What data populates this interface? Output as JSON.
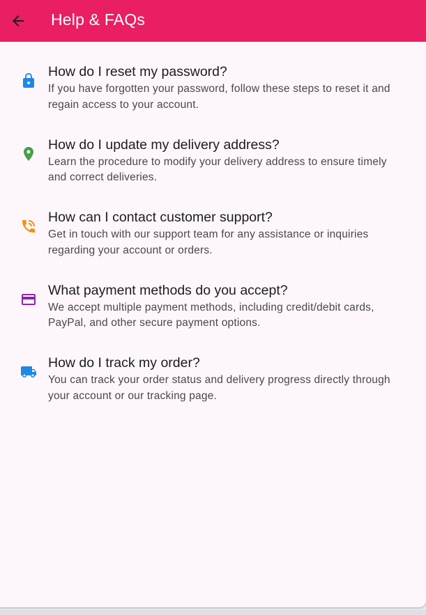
{
  "app_bar": {
    "title": "Help & FAQs",
    "background_color": "#e91e63",
    "back_icon": "arrow-back-icon"
  },
  "faqs": [
    {
      "icon": "lock-icon",
      "icon_color": "#1e88e5",
      "question": "How do I reset my password?",
      "answer": "If you have forgotten your password, follow these steps to reset it and regain access to your account."
    },
    {
      "icon": "location-pin-icon",
      "icon_color": "#43a047",
      "question": "How do I update my delivery address?",
      "answer": "Learn the procedure to modify your delivery address to ensure timely and correct deliveries."
    },
    {
      "icon": "phone-in-talk-icon",
      "icon_color": "#fb8c00",
      "question": "How can I contact customer support?",
      "answer": "Get in touch with our support team for any assistance or inquiries regarding your account or orders."
    },
    {
      "icon": "credit-card-icon",
      "icon_color": "#8e24aa",
      "question": "What payment methods do you accept?",
      "answer": "We accept multiple payment methods, including credit/debit cards, PayPal, and other secure payment options."
    },
    {
      "icon": "delivery-truck-icon",
      "icon_color": "#1e88e5",
      "question": "How do I track my order?",
      "answer": "You can track your order status and delivery progress directly through your account or our tracking page."
    }
  ]
}
